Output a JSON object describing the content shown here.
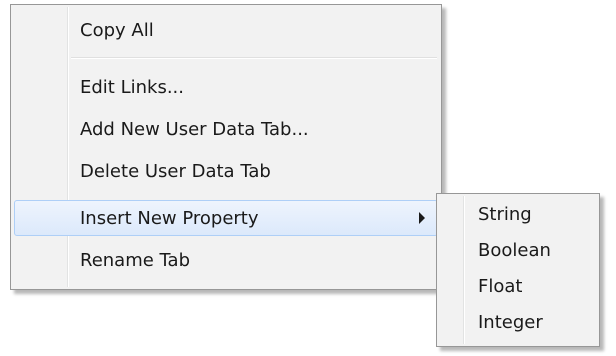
{
  "context_menu": {
    "items": [
      {
        "label": "Copy All"
      },
      {
        "label": "Edit Links..."
      },
      {
        "label": "Add New User Data Tab..."
      },
      {
        "label": "Delete User Data Tab"
      },
      {
        "label": "Insert New Property",
        "has_submenu": true,
        "highlighted": true
      },
      {
        "label": "Rename Tab"
      }
    ]
  },
  "submenu": {
    "items": [
      {
        "label": "String"
      },
      {
        "label": "Boolean"
      },
      {
        "label": "Float"
      },
      {
        "label": "Integer"
      }
    ]
  },
  "colors": {
    "menu_background": "#f2f2f2",
    "menu_border": "#979797",
    "highlight_border": "#aecff7",
    "text": "#1a1a1a"
  },
  "icons": {
    "submenu_arrow": "chevron-right-icon"
  }
}
